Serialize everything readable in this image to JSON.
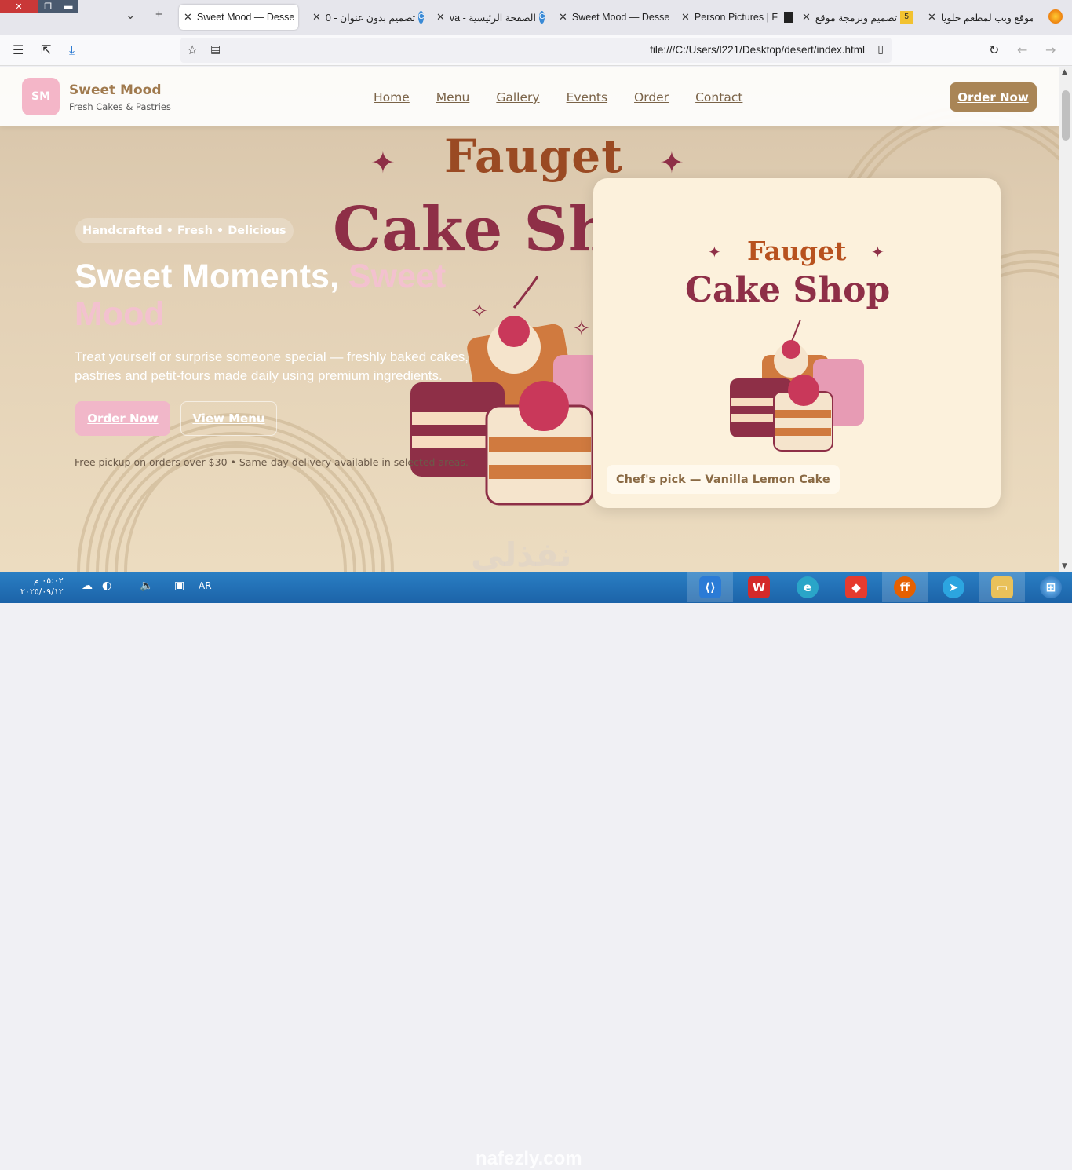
{
  "browser": {
    "tabs": [
      {
        "title": "موقع ويب لمطعم حلويا"
      },
      {
        "title": "تصميم وبرمجة موقع",
        "badge": "5"
      },
      {
        "title": "Person Pictures | F"
      },
      {
        "title": "Sweet Mood — Desse"
      },
      {
        "title": "الصفحة الرئيسية - va"
      },
      {
        "title": "تصميم بدون عنوان - 0"
      },
      {
        "title": "Sweet Mood — Desse"
      }
    ],
    "url": "file:///C:/Users/l221/Desktop/desert/index.html"
  },
  "site": {
    "logo_initials": "SM",
    "brand": "Sweet Mood",
    "tagline": "Fresh Cakes & Pastries",
    "nav": [
      "Home",
      "Menu",
      "Gallery",
      "Events",
      "Order",
      "Contact"
    ],
    "order_button": "Order Now"
  },
  "hero": {
    "bg_fauget": "Fauget",
    "bg_cake": "Cake Sh",
    "pill": "Handcrafted • Fresh • Delicious",
    "heading_main": "Sweet Moments, ",
    "heading_accent": "Sweet Mood",
    "description": "Treat yourself or surprise someone special — freshly baked cakes, pastries and petit-fours made daily using premium ingredients.",
    "primary_button": "Order Now",
    "secondary_button": "View Menu",
    "note": "Free pickup on orders over $30 • Same-day delivery available in selected areas."
  },
  "card": {
    "fauget": "Fauget",
    "cake_shop": "Cake Shop",
    "caption": "Chef's pick — Vanilla Lemon Cake"
  },
  "watermark": {
    "arabic": "نفذلي",
    "latin": "nafezly.com"
  },
  "taskbar": {
    "time": "٠٥:٠٢ م",
    "date": "٢٠٢٥/٠٩/١٢",
    "lang": "AR"
  },
  "colors": {
    "brand": "#a98556",
    "pink": "#f1b7c9",
    "cake_red": "#8e2f47",
    "orange": "#b8521f"
  }
}
